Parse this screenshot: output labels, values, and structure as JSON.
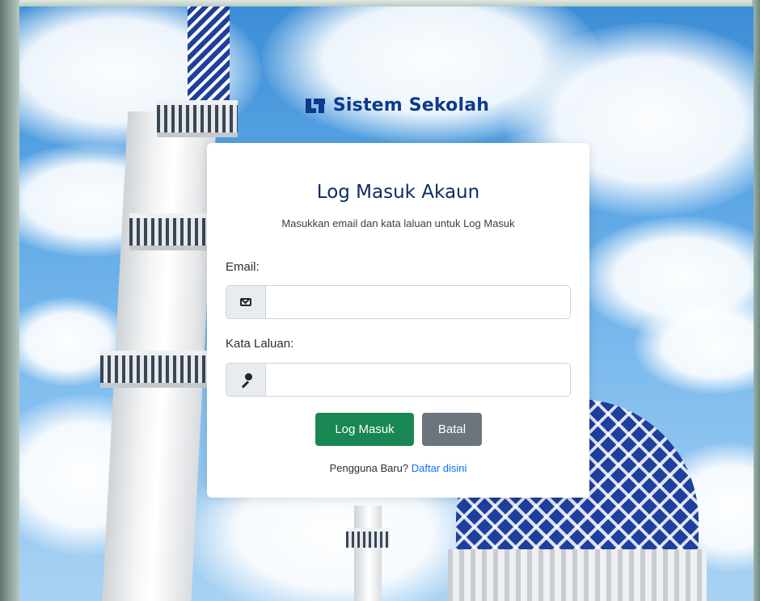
{
  "brand": {
    "name": "Sistem Sekolah",
    "color": "#0c3a8c"
  },
  "login": {
    "title": "Log Masuk Akaun",
    "subtitle": "Masukkan email dan kata laluan untuk Log Masuk",
    "email_label": "Email:",
    "email_value": "",
    "email_icon": "envelope-icon",
    "password_label": "Kata Laluan:",
    "password_value": "",
    "password_icon": "key-icon",
    "submit_label": "Log Masuk",
    "cancel_label": "Batal",
    "register_prompt": "Pengguna Baru?",
    "register_link": "Daftar disini"
  },
  "colors": {
    "primary_button": "#198754",
    "secondary_button": "#6c757d",
    "link": "#0d6efd",
    "title": "#0b2c5e"
  }
}
